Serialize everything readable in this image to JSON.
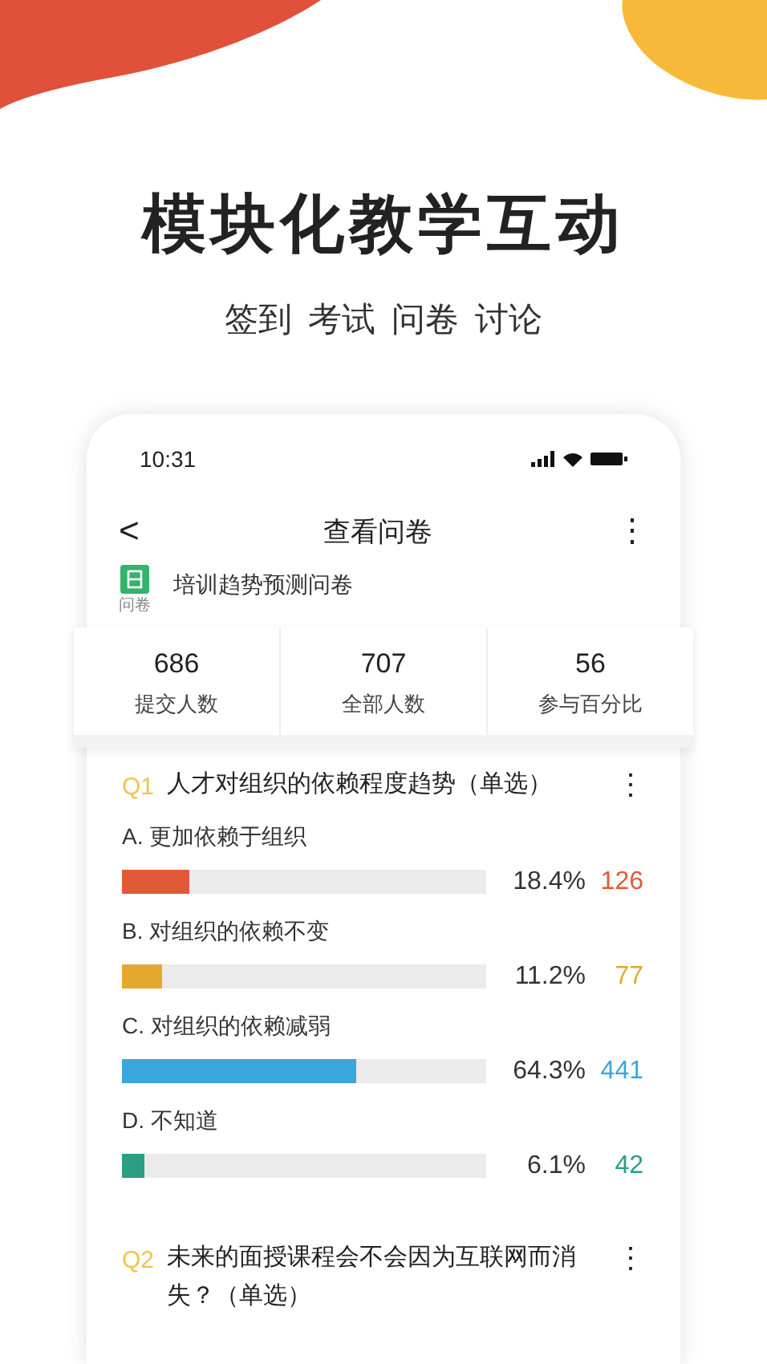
{
  "headline": "模块化教学互动",
  "subtitle": [
    "签到",
    "考试",
    "问卷",
    "讨论"
  ],
  "status_bar": {
    "time": "10:31"
  },
  "nav": {
    "back": "<",
    "title": "查看问卷",
    "more": "⋮"
  },
  "survey": {
    "badge": "问卷",
    "title": "培训趋势预测问卷"
  },
  "stats": [
    {
      "value": "686",
      "label": "提交人数"
    },
    {
      "value": "707",
      "label": "全部人数"
    },
    {
      "value": "56",
      "label": "参与百分比"
    }
  ],
  "questions": [
    {
      "number": "Q1",
      "text": "人才对组织的依赖程度趋势（单选）",
      "more": "⋮",
      "options": [
        {
          "label": "A. 更加依赖于组织",
          "level": 0.184,
          "percent": "18.4%",
          "count": "126",
          "color": "#e05a38"
        },
        {
          "label": "B. 对组织的依赖不变",
          "level": 0.112,
          "percent": "11.2%",
          "count": "77",
          "color": "#e4a82e"
        },
        {
          "label": "C. 对组织的依赖减弱",
          "level": 0.643,
          "percent": "64.3%",
          "count": "441",
          "color": "#3aa6dc"
        },
        {
          "label": "D. 不知道",
          "level": 0.061,
          "percent": "6.1%",
          "count": "42",
          "color": "#2c9e83"
        }
      ]
    },
    {
      "number": "Q2",
      "text": "未来的面授课程会不会因为互联网而消失？（单选）",
      "more": "⋮"
    }
  ]
}
